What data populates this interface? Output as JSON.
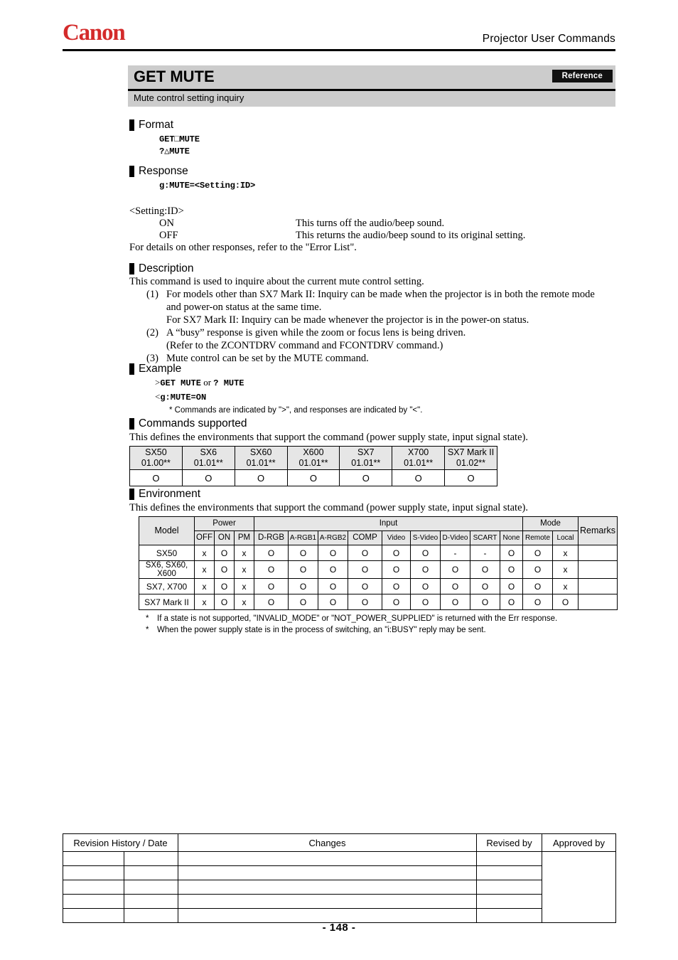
{
  "header": {
    "logo_text": "Canon",
    "logo_color": "#d42b2b",
    "document_title": "Projector  User  Commands"
  },
  "title_block": {
    "command_name": "GET MUTE",
    "badge_label": "Reference",
    "subtitle": "Mute control setting inquiry"
  },
  "format": {
    "heading": "Format",
    "lines": [
      "GET□MUTE",
      "?△MUTE"
    ]
  },
  "response": {
    "heading": "Response",
    "syntax": "g:MUTE=<Setting:ID>",
    "setting_id_label": "<Setting:ID>",
    "values": [
      {
        "name": "ON",
        "description": "This turns off the audio/beep sound."
      },
      {
        "name": "OFF",
        "description": "This returns the audio/beep sound to its original setting."
      }
    ],
    "error_note": "For details on other responses, refer to the \"Error List\"."
  },
  "description": {
    "heading": "Description",
    "intro": "This command is used to inquire about the current mute control setting.",
    "items": [
      {
        "number": "(1)",
        "text": "For models other than SX7 Mark II: Inquiry can be made when the projector is in both the remote mode",
        "continuations": [
          "and power-on status at the same time.",
          "For SX7 Mark II: Inquiry can be made whenever the projector is in the power-on status."
        ]
      },
      {
        "number": "(2)",
        "text": "A “busy” response is given while the zoom or focus lens is being driven.",
        "continuations": [
          "(Refer to the ZCONTDRV command and FCONTDRV command.)"
        ]
      },
      {
        "number": "(3)",
        "text": "Mute control can be set by the MUTE command.",
        "continuations": []
      }
    ]
  },
  "example": {
    "heading": "Example",
    "command_prefix": ">",
    "command_text": "GET  MUTE",
    "command_or": " or ",
    "command_alt": "?  MUTE",
    "response_prefix": "<",
    "response_text": "g:MUTE=ON",
    "note": "* Commands are indicated by \">\", and responses are indicated by \"<\"."
  },
  "commands_supported": {
    "heading": "Commands supported",
    "description": "This defines the environments that support the command (power supply state, input signal state).",
    "columns": [
      {
        "model": "SX50",
        "version": "01.00**"
      },
      {
        "model": "SX6",
        "version": "01.01**"
      },
      {
        "model": "SX60",
        "version": "01.01**"
      },
      {
        "model": "X600",
        "version": "01.01**"
      },
      {
        "model": "SX7",
        "version": "01.01**"
      },
      {
        "model": "X700",
        "version": "01.01**"
      },
      {
        "model": "SX7 Mark II",
        "version": "01.02**"
      }
    ],
    "support": [
      "O",
      "O",
      "O",
      "O",
      "O",
      "O",
      "O"
    ]
  },
  "environment": {
    "heading": "Environment",
    "description": "This defines the environments that support the command (power supply state, input signal state).",
    "group_headers": {
      "model": "Model",
      "power": "Power",
      "input": "Input",
      "mode": "Mode",
      "remarks": "Remarks"
    },
    "sub_headers": {
      "power": [
        "OFF",
        "ON",
        "PM"
      ],
      "input": [
        "D-RGB",
        "A-RGB1",
        "A-RGB2",
        "COMP",
        "Video",
        "S-Video",
        "D-Video",
        "SCART",
        "None"
      ],
      "mode": [
        "Remote",
        "Local"
      ]
    },
    "rows": [
      {
        "model": "SX50",
        "model_lines": [
          "SX50"
        ],
        "power": [
          "x",
          "O",
          "x"
        ],
        "input": [
          "O",
          "O",
          "O",
          "O",
          "O",
          "O",
          "-",
          "-",
          "O"
        ],
        "mode": [
          "O",
          "x"
        ],
        "remarks": ""
      },
      {
        "model": "SX6, SX60, X600",
        "model_lines": [
          "SX6, SX60,",
          "X600"
        ],
        "power": [
          "x",
          "O",
          "x"
        ],
        "input": [
          "O",
          "O",
          "O",
          "O",
          "O",
          "O",
          "O",
          "O",
          "O"
        ],
        "mode": [
          "O",
          "x"
        ],
        "remarks": ""
      },
      {
        "model": "SX7, X700",
        "model_lines": [
          "SX7, X700"
        ],
        "power": [
          "x",
          "O",
          "x"
        ],
        "input": [
          "O",
          "O",
          "O",
          "O",
          "O",
          "O",
          "O",
          "O",
          "O"
        ],
        "mode": [
          "O",
          "x"
        ],
        "remarks": ""
      },
      {
        "model": "SX7 Mark II",
        "model_lines": [
          "SX7 Mark II"
        ],
        "power": [
          "x",
          "O",
          "x"
        ],
        "input": [
          "O",
          "O",
          "O",
          "O",
          "O",
          "O",
          "O",
          "O",
          "O"
        ],
        "mode": [
          "O",
          "O"
        ],
        "remarks": ""
      }
    ],
    "footnotes": [
      "If a state is not supported, \"INVALID_MODE\" or \"NOT_POWER_SUPPLIED\" is returned with the Err response.",
      "When the power supply state is in the process of switching, an \"i:BUSY\" reply may be sent."
    ],
    "footnote_marker": "*"
  },
  "revision_table": {
    "headers": [
      "Revision History / Date",
      "Changes",
      "Revised by",
      "Approved by"
    ],
    "rows": [
      {
        "date_a": "",
        "date_b": "",
        "changes": "",
        "revised_by": ""
      },
      {
        "date_a": "",
        "date_b": "",
        "changes": "",
        "revised_by": ""
      },
      {
        "date_a": "",
        "date_b": "",
        "changes": "",
        "revised_by": ""
      },
      {
        "date_a": "",
        "date_b": "",
        "changes": "",
        "revised_by": ""
      },
      {
        "date_a": "",
        "date_b": "",
        "changes": "",
        "revised_by": ""
      }
    ],
    "approved_by_value": ""
  },
  "footer": {
    "page_number": "- 148 -"
  }
}
